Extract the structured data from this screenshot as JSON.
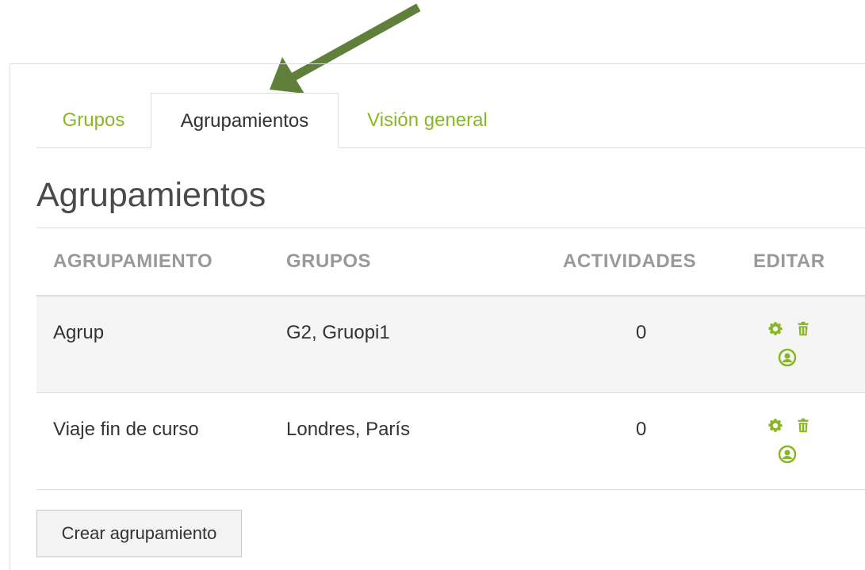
{
  "tabs": [
    {
      "label": "Grupos",
      "active": false
    },
    {
      "label": "Agrupamientos",
      "active": true
    },
    {
      "label": "Visión general",
      "active": false
    }
  ],
  "page_title": "Agrupamientos",
  "table": {
    "headers": {
      "agrupamiento": "AGRUPAMIENTO",
      "grupos": "GRUPOS",
      "actividades": "ACTIVIDADES",
      "editar": "EDITAR"
    },
    "rows": [
      {
        "agrupamiento": "Agrup",
        "grupos": "G2, Gruopi1",
        "actividades": "0",
        "edit_icons": [
          "gear-icon",
          "trash-icon",
          "user-icon"
        ]
      },
      {
        "agrupamiento": "Viaje fin de curso",
        "grupos": "Londres, París",
        "actividades": "0",
        "edit_icons": [
          "gear-icon",
          "trash-icon",
          "user-icon"
        ]
      }
    ]
  },
  "create_button": "Crear agrupamiento",
  "colors": {
    "accent": "#8ab527",
    "arrow": "#5f7f3a",
    "header_text": "#999999",
    "row_stripe": "#f5f5f5"
  }
}
